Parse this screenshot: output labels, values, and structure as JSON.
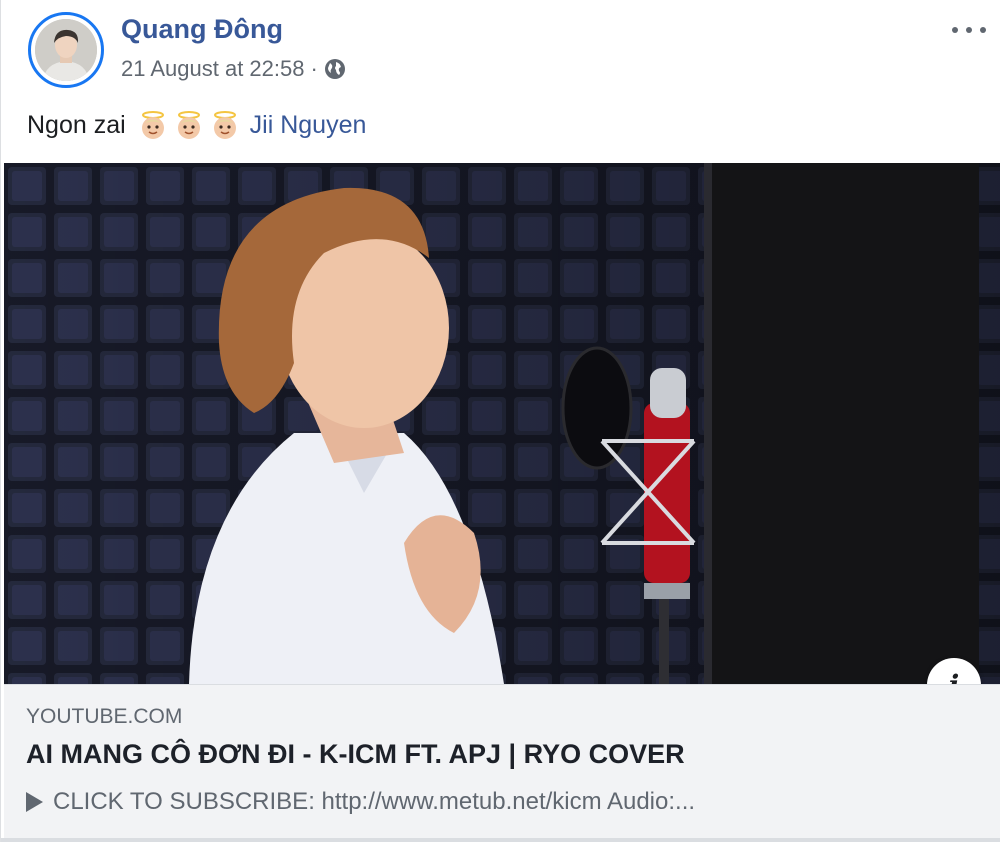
{
  "post": {
    "author": "Quang Đông",
    "timestamp": "21 August at 22:58",
    "separator": "·",
    "privacy_icon": "globe-icon",
    "text": "Ngon zai",
    "emojis": [
      "baby-angel-emoji",
      "baby-angel-emoji",
      "baby-angel-emoji"
    ],
    "mention": "Jii Nguyen"
  },
  "link_preview": {
    "domain": "YOUTUBE.COM",
    "title": "AI MANG CÔ ĐƠN ĐI - K-ICM FT. APJ | RYO COVER",
    "description": "CLICK TO SUBSCRIBE: http://www.metub.net/kicm Audio:...",
    "info_glyph": "i"
  },
  "colors": {
    "link": "#385898",
    "avatar_ring": "#1877f2",
    "secondary_text": "#606770",
    "preview_bg": "#f2f3f5"
  }
}
